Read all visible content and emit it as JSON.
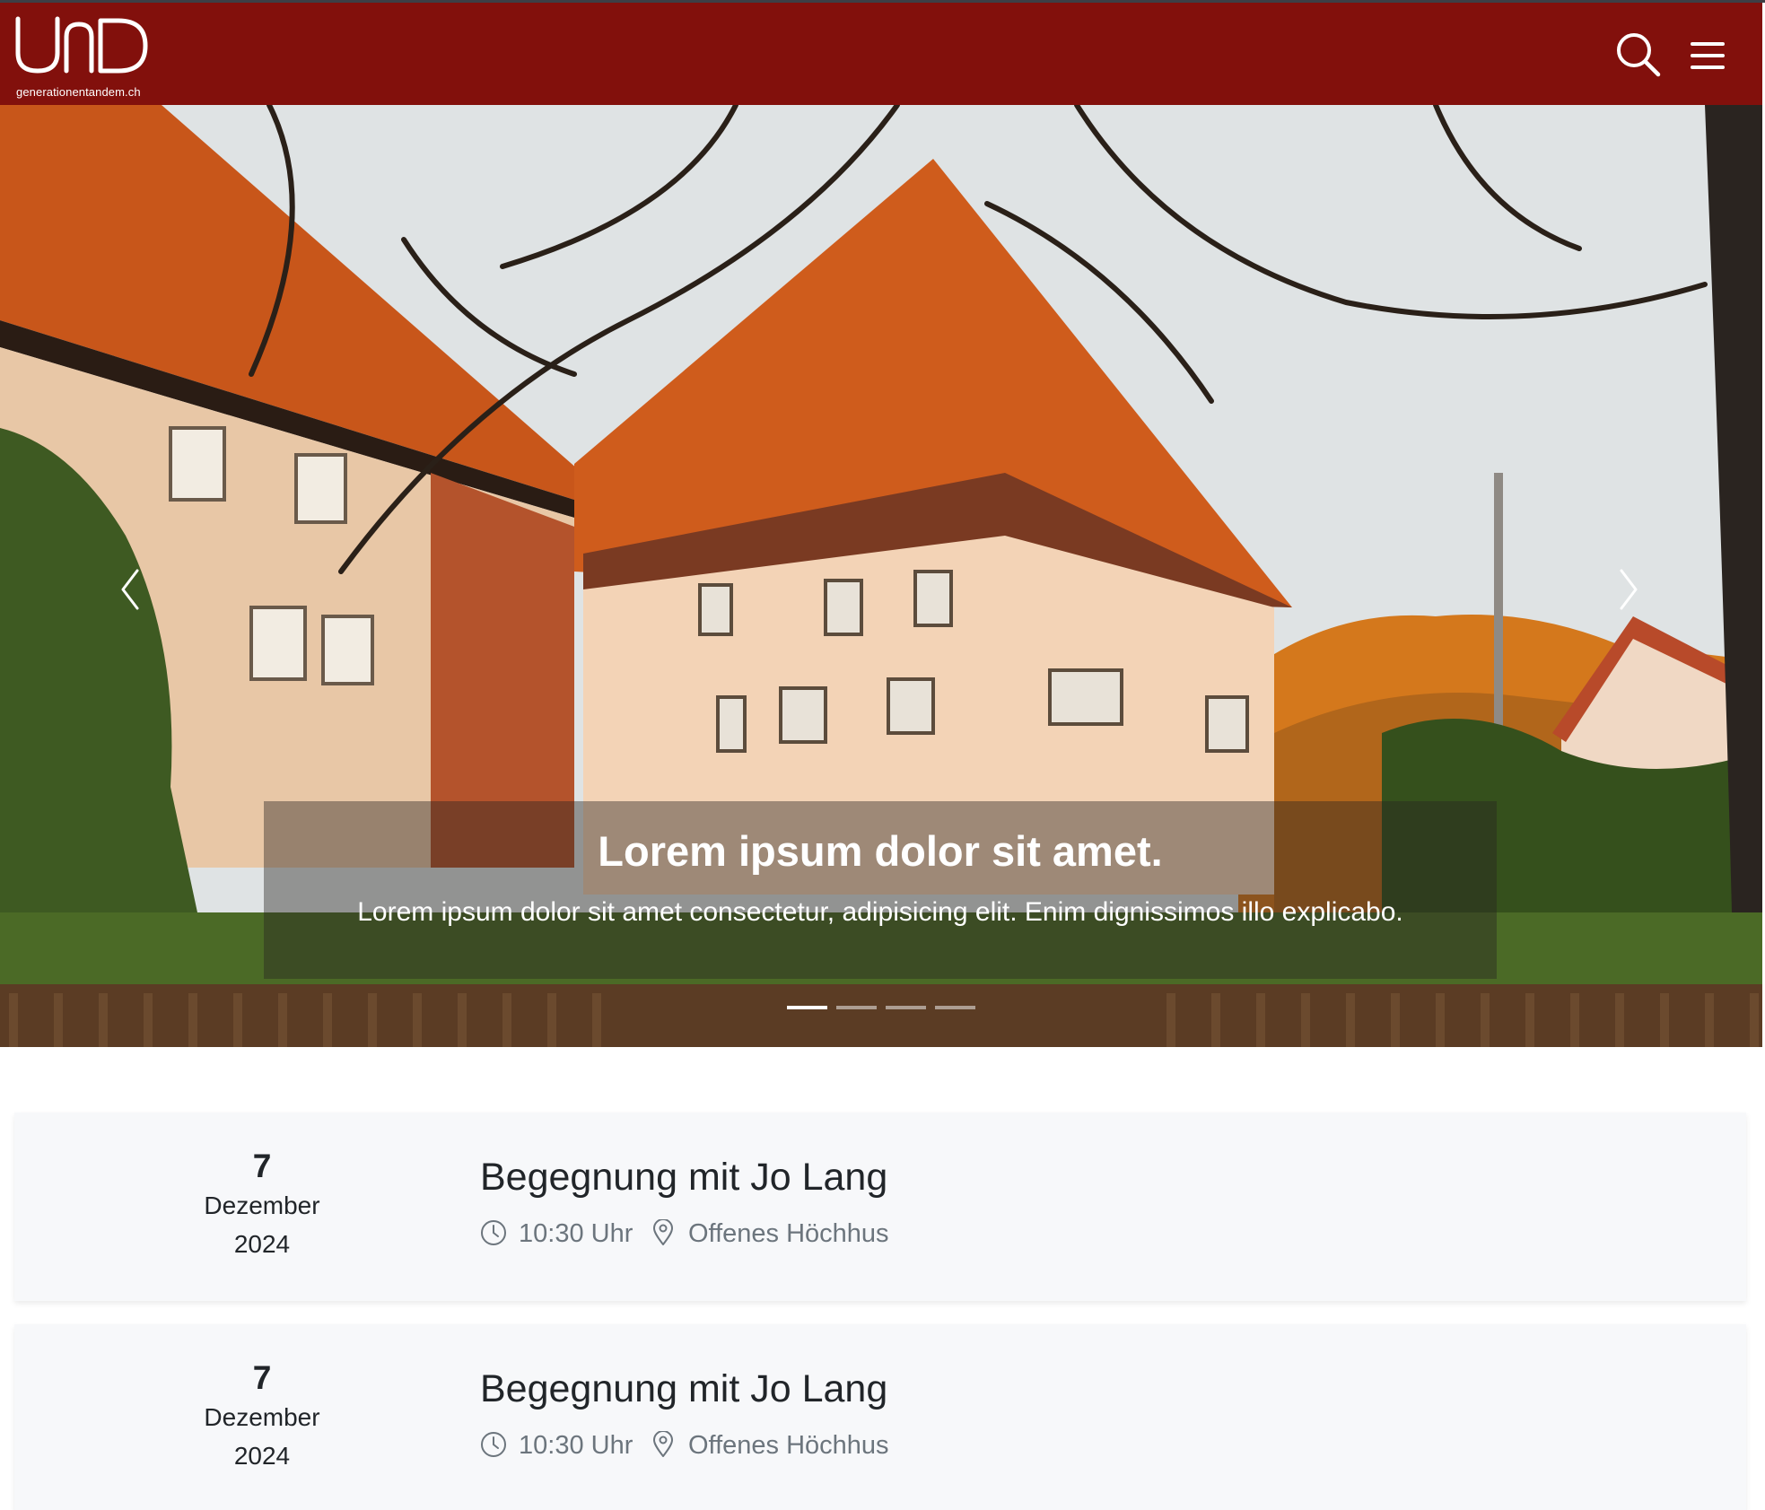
{
  "header": {
    "logo_text": "generationentandem.ch",
    "brand_color": "#82100c",
    "icons": [
      "search-icon",
      "menu-icon"
    ]
  },
  "hero": {
    "caption": {
      "title": "Lorem ipsum dolor sit amet.",
      "text": "Lorem ipsum dolor sit amet consectetur, adipisicing elit. Enim dignissimos illo explicabo."
    },
    "slides_count": 4,
    "active_slide": 1,
    "icons": [
      "chevron-left-icon",
      "chevron-right-icon"
    ]
  },
  "events": [
    {
      "day": "7",
      "month": "Dezember",
      "year": "2024",
      "title": "Begegnung mit Jo Lang",
      "time": "10:30 Uhr",
      "place": "Offenes Höchhus"
    },
    {
      "day": "7",
      "month": "Dezember",
      "year": "2024",
      "title": "Begegnung mit Jo Lang",
      "time": "10:30 Uhr",
      "place": "Offenes Höchhus"
    }
  ]
}
